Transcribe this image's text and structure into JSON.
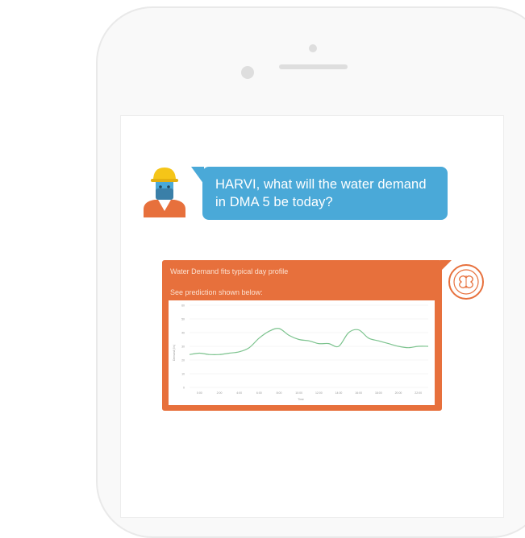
{
  "user_message": "HARVI, what will the water demand in DMA 5 be today?",
  "bot_reply": {
    "title": "Water Demand fits typical day profile",
    "subtitle": "See prediction shown below:"
  },
  "colors": {
    "user_bubble": "#4aa9d8",
    "bot_card": "#e7703c",
    "line": "#7cc38e"
  },
  "chart_data": {
    "type": "line",
    "x_ticks": [
      "0:00",
      "2:00",
      "4:00",
      "6:00",
      "8:00",
      "10:00",
      "12:00",
      "14:00",
      "16:00",
      "18:00",
      "20:00",
      "22:00"
    ],
    "y_ticks": [
      "0",
      "10",
      "20",
      "30",
      "40",
      "50",
      "60"
    ],
    "xlabel": "Time",
    "ylabel": "Demand (l/s)",
    "ylim": [
      0,
      60
    ],
    "series": [
      {
        "x": [
          0,
          1,
          2,
          3,
          4,
          5,
          6,
          7,
          8,
          9,
          10,
          11,
          12,
          13,
          14,
          15,
          16,
          17,
          18,
          19,
          20,
          21,
          22,
          23,
          24
        ],
        "values": [
          24,
          25,
          24,
          24,
          25,
          26,
          29,
          36,
          41,
          43,
          38,
          35,
          34,
          32,
          32,
          30,
          40,
          42,
          36,
          34,
          32,
          30,
          29,
          30,
          30
        ]
      }
    ]
  }
}
